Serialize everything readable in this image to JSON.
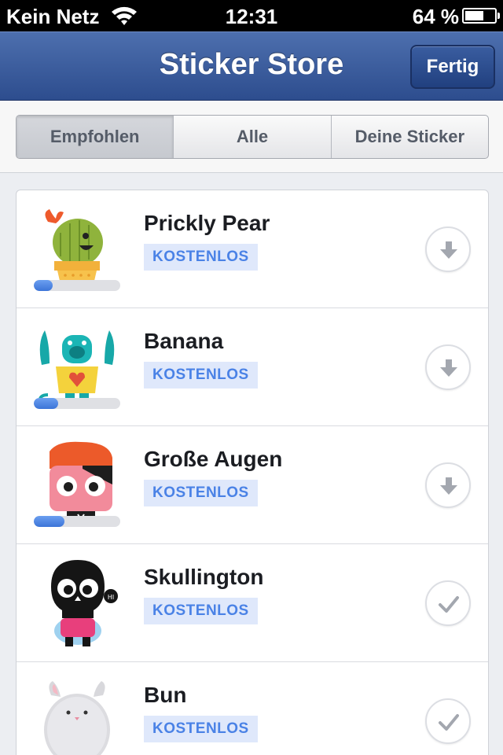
{
  "status_bar": {
    "carrier": "Kein Netz",
    "time": "12:31",
    "battery_percent_text": "64 %",
    "battery_level": 0.64,
    "wifi_icon": "wifi-icon"
  },
  "nav_bar": {
    "title": "Sticker Store",
    "done_label": "Fertig"
  },
  "segmented": {
    "tabs": [
      "Empfohlen",
      "Alle",
      "Deine Sticker"
    ],
    "selected_index": 0
  },
  "stickers": [
    {
      "name": "Prickly Pear",
      "price": "KOSTENLOS",
      "action_icon": "download-icon",
      "download_progress": 0.22
    },
    {
      "name": "Banana",
      "price": "KOSTENLOS",
      "action_icon": "download-icon",
      "download_progress": 0.28
    },
    {
      "name": "Große Augen",
      "price": "KOSTENLOS",
      "action_icon": "download-icon",
      "download_progress": 0.35
    },
    {
      "name": "Skullington",
      "price": "KOSTENLOS",
      "action_icon": "checkmark-icon"
    },
    {
      "name": "Bun",
      "price": "KOSTENLOS",
      "action_icon": "checkmark-icon"
    }
  ],
  "colors": {
    "nav_bar": "#3b5998",
    "badge_text": "#4a82e6",
    "badge_bg": "#dfe8fb",
    "progress": "#4a7fe0"
  }
}
